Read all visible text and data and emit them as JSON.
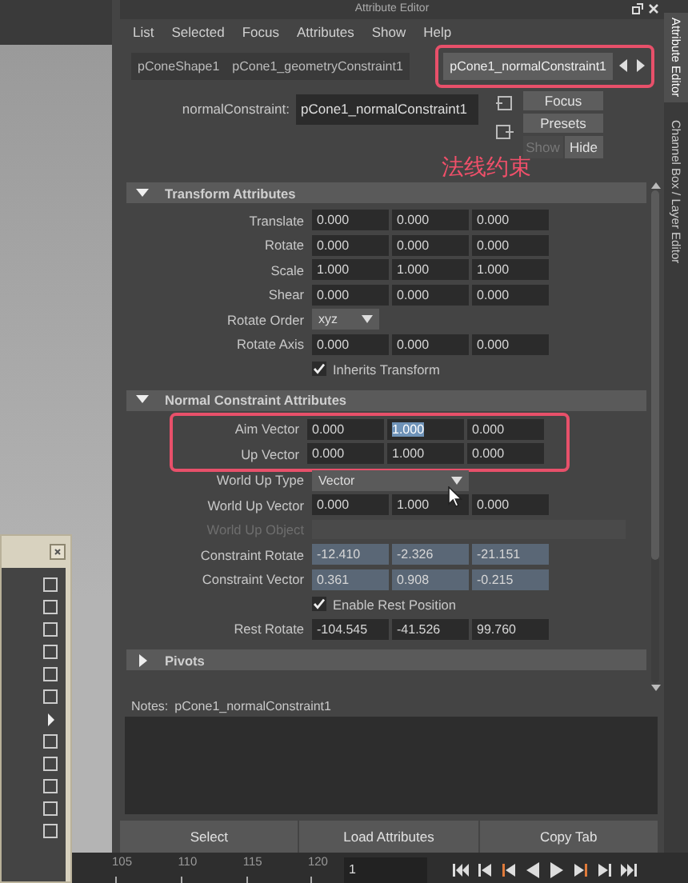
{
  "window": {
    "title": "Attribute Editor"
  },
  "menu": [
    "List",
    "Selected",
    "Focus",
    "Attributes",
    "Show",
    "Help"
  ],
  "tab_bar": {
    "highlighted": true,
    "tabs": [
      {
        "label": "pConeShape1",
        "selected": false
      },
      {
        "label": "pCone1_geometryConstraint1",
        "selected": false
      },
      {
        "label": "pCone1_normalConstraint1",
        "selected": true
      }
    ]
  },
  "node": {
    "label": "normalConstraint:",
    "value": "pCone1_normalConstraint1"
  },
  "side_buttons": [
    "Focus",
    "Presets"
  ],
  "show_hide": [
    {
      "label": "Show",
      "selected": false
    },
    {
      "label": "Hide",
      "selected": true
    }
  ],
  "annotation": "法线约束",
  "sections": [
    {
      "title": "Transform Attributes",
      "expanded": true,
      "rows": [
        {
          "kind": "vector",
          "label": "Translate",
          "values": [
            {
              "text": "0.000",
              "selected": false
            },
            {
              "text": "0.000",
              "selected": false
            },
            {
              "text": "0.000",
              "selected": false
            }
          ]
        },
        {
          "kind": "vector",
          "label": "Rotate",
          "values": [
            {
              "text": "0.000",
              "selected": false
            },
            {
              "text": "0.000",
              "selected": false
            },
            {
              "text": "0.000",
              "selected": false
            }
          ]
        },
        {
          "kind": "vector",
          "label": "Scale",
          "values": [
            {
              "text": "1.000",
              "selected": false
            },
            {
              "text": "1.000",
              "selected": false
            },
            {
              "text": "1.000",
              "selected": false
            }
          ]
        },
        {
          "kind": "vector",
          "label": "Shear",
          "values": [
            {
              "text": "0.000",
              "selected": false
            },
            {
              "text": "0.000",
              "selected": false
            },
            {
              "text": "0.000",
              "selected": false
            }
          ]
        },
        {
          "kind": "dropdown",
          "label": "Rotate Order",
          "value": "xyz"
        },
        {
          "kind": "vector",
          "label": "Rotate Axis",
          "values": [
            {
              "text": "0.000",
              "selected": false
            },
            {
              "text": "0.000",
              "selected": false
            },
            {
              "text": "0.000",
              "selected": false
            }
          ]
        },
        {
          "kind": "checkbox",
          "label": "Inherits Transform",
          "checked": true
        }
      ]
    },
    {
      "title": "Normal Constraint Attributes",
      "expanded": true,
      "rows": [
        {
          "kind": "vector",
          "label": "Aim Vector",
          "highlighted": true,
          "values": [
            {
              "text": "0.000",
              "selected": false
            },
            {
              "text": "1.000",
              "selected": true
            },
            {
              "text": "0.000",
              "selected": false
            }
          ]
        },
        {
          "kind": "vector",
          "label": "Up Vector",
          "highlighted": true,
          "values": [
            {
              "text": "0.000",
              "selected": false
            },
            {
              "text": "1.000",
              "selected": false
            },
            {
              "text": "0.000",
              "selected": false
            }
          ]
        },
        {
          "kind": "dropdown",
          "label": "World Up Type",
          "value": "Vector"
        },
        {
          "kind": "vector",
          "label": "World Up Vector",
          "values": [
            {
              "text": "0.000",
              "selected": false
            },
            {
              "text": "1.000",
              "selected": false
            },
            {
              "text": "0.000",
              "selected": false
            }
          ]
        },
        {
          "kind": "text",
          "label": "World Up Object",
          "disabled": true
        },
        {
          "kind": "vector",
          "label": "Constraint Rotate",
          "driven": true,
          "values": [
            {
              "text": "-12.410",
              "selected": false
            },
            {
              "text": "-2.326",
              "selected": false
            },
            {
              "text": "-21.151",
              "selected": false
            }
          ]
        },
        {
          "kind": "vector",
          "label": "Constraint Vector",
          "driven": true,
          "values": [
            {
              "text": "0.361",
              "selected": false
            },
            {
              "text": "0.908",
              "selected": false
            },
            {
              "text": "-0.215",
              "selected": false
            }
          ]
        },
        {
          "kind": "checkbox",
          "label": "Enable Rest Position",
          "checked": true
        },
        {
          "kind": "vector",
          "label": "Rest Rotate",
          "values": [
            {
              "text": "-104.545",
              "selected": false
            },
            {
              "text": "-41.526",
              "selected": false
            },
            {
              "text": "99.760",
              "selected": false
            }
          ]
        }
      ]
    },
    {
      "title": "Pivots",
      "expanded": false
    }
  ],
  "notes": {
    "label": "Notes:",
    "node": "pCone1_normalConstraint1"
  },
  "buttons": [
    "Select",
    "Load Attributes",
    "Copy Tab"
  ],
  "side_tabs": [
    {
      "label": "Attribute Editor",
      "selected": true
    },
    {
      "label": "Channel Box / Layer Editor",
      "selected": false
    }
  ],
  "float_panel": {
    "rows": [
      {
        "kind": "check",
        "checked": false
      },
      {
        "kind": "check",
        "checked": false
      },
      {
        "kind": "check",
        "checked": false
      },
      {
        "kind": "check",
        "checked": false
      },
      {
        "kind": "check",
        "checked": false
      },
      {
        "kind": "check",
        "checked": false
      },
      {
        "kind": "submenu"
      },
      {
        "kind": "check",
        "checked": false
      },
      {
        "kind": "check",
        "checked": false
      },
      {
        "kind": "check",
        "checked": false
      },
      {
        "kind": "check",
        "checked": false
      },
      {
        "kind": "check",
        "checked": false
      }
    ]
  },
  "timeline": {
    "ticks": [
      "105",
      "110",
      "115",
      "120"
    ],
    "frame": "1"
  }
}
